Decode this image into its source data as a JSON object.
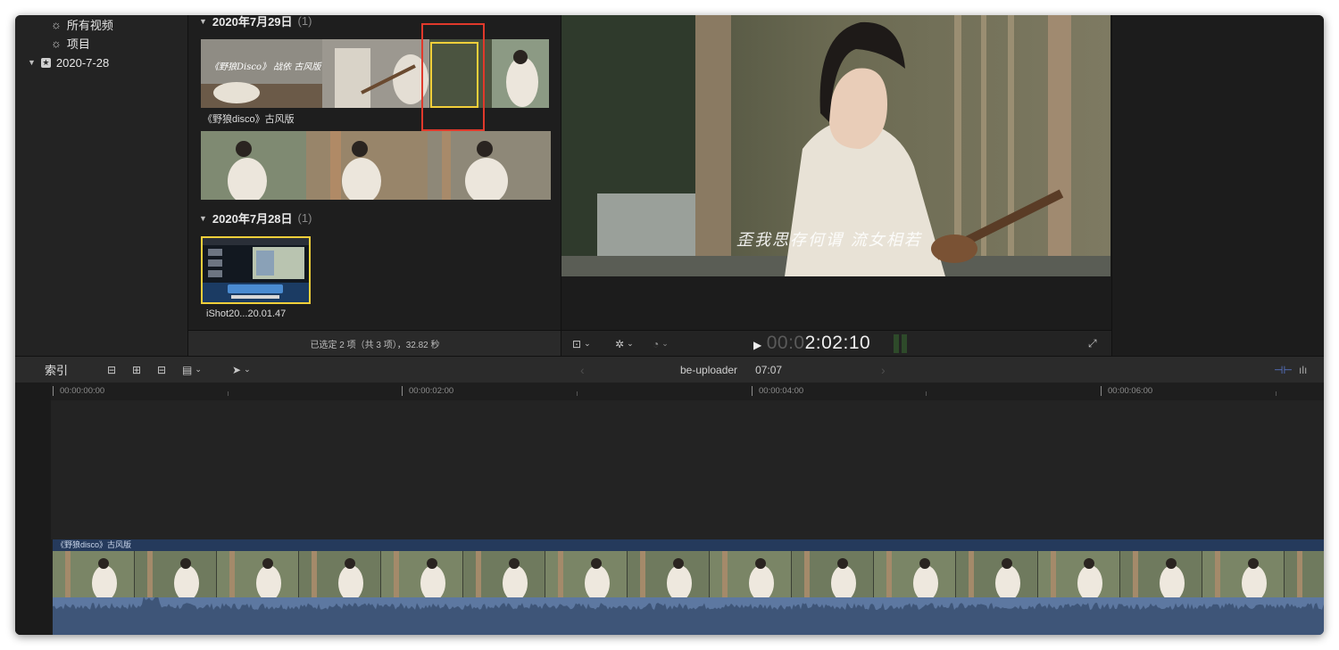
{
  "library": {
    "items": [
      {
        "label": "所有视频",
        "icon": "gear-icon"
      },
      {
        "label": "项目",
        "icon": "gear-icon"
      },
      {
        "label": "2020-7-28",
        "icon": "star-icon"
      }
    ]
  },
  "browser": {
    "events": [
      {
        "date": "2020年7月29日",
        "count": "(1)"
      },
      {
        "date": "2020年7月28日",
        "count": "(1)"
      }
    ],
    "clips": [
      {
        "name": "《野狼disco》古风版"
      },
      {
        "name": "iShot20...20.01.47"
      }
    ],
    "thumb_caption_1": "《野狼Disco》 战依 古风版",
    "status": "已选定 2 项（共 3 项），32.82 秒"
  },
  "viewer": {
    "subtitle": "歪我思存何谓 流女相若",
    "timecode_dim": "00:0",
    "timecode_bright": "2:02:10"
  },
  "timeline_toolbar": {
    "index_label": "索引",
    "project_name": "be-uploader",
    "project_duration": "07:07"
  },
  "timeline": {
    "ruler": [
      "00:00:00:00",
      "00:00:02:00",
      "00:00:04:00",
      "00:00:06:00"
    ],
    "clip_title": "《野狼disco》古风版"
  },
  "colors": {
    "window_bg": "#1f1f20",
    "selection_yellow": "#f2cf3a",
    "annotation_red": "#e0392b",
    "audio_waveform": "#5d78a1",
    "clip_title_bar": "#253a5c"
  }
}
